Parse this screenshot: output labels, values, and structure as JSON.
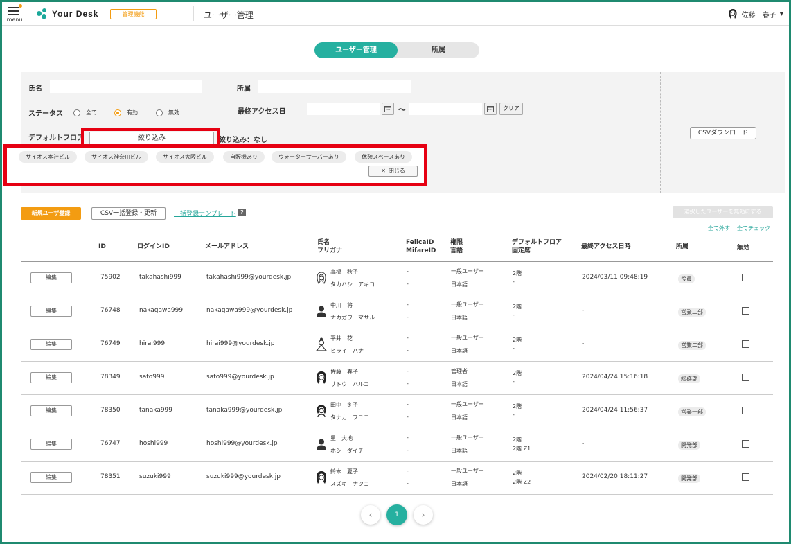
{
  "header": {
    "menu_label": "menu",
    "logo_text": "Your Desk",
    "admin_badge": "管理機能",
    "page_title": "ユーザー管理",
    "user_name": "佐藤　春子"
  },
  "tabs": [
    {
      "label": "ユーザー管理",
      "active": true
    },
    {
      "label": "所属",
      "active": false
    }
  ],
  "filter": {
    "name_label": "氏名",
    "name_value": "",
    "dept_label": "所属",
    "dept_value": "",
    "status_label": "ステータス",
    "status_options": [
      {
        "label": "全て",
        "selected": false
      },
      {
        "label": "有効",
        "selected": true
      },
      {
        "label": "無効",
        "selected": false
      }
    ],
    "last_access_label": "最終アクセス日",
    "date_from": "",
    "date_to": "",
    "tilde": "〜",
    "clear_label": "クリア",
    "default_floor_label": "デフォルトフロア",
    "dropdown_label": "絞り込み",
    "dropdown_result": "絞り込み：なし",
    "chips": [
      "サイオス本社ビル",
      "サイオス神奈川ビル",
      "サイオス大阪ビル",
      "自販機あり",
      "ウォーターサーバーあり",
      "休憩スペースあり"
    ],
    "close_label": "閉じる",
    "csv_download": "CSVダウンロード"
  },
  "actions": {
    "new_user": "新規ユーザ登録",
    "csv_bulk": "CSV一括登録・更新",
    "template_link": "一括登録テンプレート",
    "help": "?",
    "disable_selected": "選択したユーザーを無効にする",
    "uncheck_all": "全て外す",
    "check_all": "全てチェック"
  },
  "table": {
    "headers": {
      "id": "ID",
      "login": "ログインID",
      "mail": "メールアドレス",
      "name1": "氏名",
      "name2": "フリガナ",
      "felica1": "FelicaID",
      "felica2": "MifareID",
      "role1": "権限",
      "role2": "言語",
      "floor1": "デフォルトフロア",
      "floor2": "固定席",
      "last_access": "最終アクセス日時",
      "dept": "所属",
      "disabled": "無効"
    },
    "edit_label": "編集",
    "rows": [
      {
        "id": "75902",
        "login": "takahashi999",
        "email": "takahashi999@yourdesk.jp",
        "name": "高橋　秋子",
        "kana": "タカハシ　アキコ",
        "felica": "-",
        "mifare": "-",
        "role": "一般ユーザー",
        "lang": "日本語",
        "floor": "2階",
        "seat": "-",
        "last_access": "2024/03/11 09:48:19",
        "dept": "役員",
        "avatar": "woman-outline-icon"
      },
      {
        "id": "76748",
        "login": "nakagawa999",
        "email": "nakagawa999@yourdesk.jp",
        "name": "中川　将",
        "kana": "ナカガワ　マサル",
        "felica": "-",
        "mifare": "-",
        "role": "一般ユーザー",
        "lang": "日本語",
        "floor": "2階",
        "seat": "-",
        "last_access": "-",
        "dept": "営業二部",
        "avatar": "man-icon"
      },
      {
        "id": "76749",
        "login": "hirai999",
        "email": "hirai999@yourdesk.jp",
        "name": "平井　花",
        "kana": "ヒライ　ハナ",
        "felica": "-",
        "mifare": "-",
        "role": "一般ユーザー",
        "lang": "日本語",
        "floor": "2階",
        "seat": "-",
        "last_access": "-",
        "dept": "営業二部",
        "avatar": "woman-bun-icon"
      },
      {
        "id": "78349",
        "login": "sato999",
        "email": "sato999@yourdesk.jp",
        "name": "佐藤　春子",
        "kana": "サトウ　ハルコ",
        "felica": "-",
        "mifare": "-",
        "role": "管理者",
        "lang": "日本語",
        "floor": "2階",
        "seat": "-",
        "last_access": "2024/04/24 15:16:18",
        "dept": "総務部",
        "avatar": "woman-hair-icon"
      },
      {
        "id": "78350",
        "login": "tanaka999",
        "email": "tanaka999@yourdesk.jp",
        "name": "田中　冬子",
        "kana": "タナカ　フユコ",
        "felica": "-",
        "mifare": "-",
        "role": "一般ユーザー",
        "lang": "日本語",
        "floor": "2階",
        "seat": "-",
        "last_access": "2024/04/24 11:56:37",
        "dept": "営業一部",
        "avatar": "woman-short-icon"
      },
      {
        "id": "76747",
        "login": "hoshi999",
        "email": "hoshi999@yourdesk.jp",
        "name": "星　大地",
        "kana": "ホシ　ダイチ",
        "felica": "-",
        "mifare": "-",
        "role": "一般ユーザー",
        "lang": "日本語",
        "floor": "2階",
        "seat": "2階 Z1",
        "last_access": "-",
        "dept": "開発部",
        "avatar": "man-icon"
      },
      {
        "id": "78351",
        "login": "suzuki999",
        "email": "suzuki999@yourdesk.jp",
        "name": "鈴木　夏子",
        "kana": "スズキ　ナツコ",
        "felica": "-",
        "mifare": "-",
        "role": "一般ユーザー",
        "lang": "日本語",
        "floor": "2階",
        "seat": "2階 Z2",
        "last_access": "2024/02/20 18:11:27",
        "dept": "開発部",
        "avatar": "woman-long-icon"
      }
    ]
  },
  "pagination": {
    "prev": "‹",
    "current": "1",
    "next": "›"
  },
  "colors": {
    "accent": "#26b0a0",
    "orange": "#f39c12",
    "highlight": "#e60012"
  }
}
